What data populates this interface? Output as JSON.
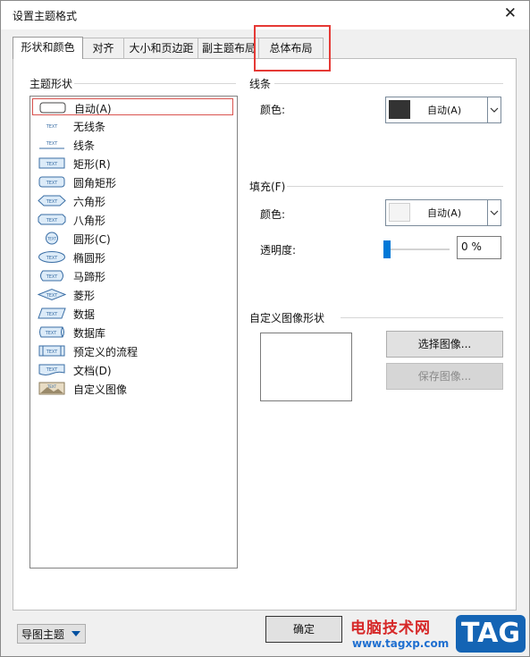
{
  "window": {
    "title": "设置主题格式",
    "close_icon": "close-icon"
  },
  "tabs": [
    {
      "label": "形状和颜色",
      "active": true
    },
    {
      "label": "对齐"
    },
    {
      "label": "大小和页边距"
    },
    {
      "label": "副主题布局"
    },
    {
      "label": "总体布局"
    }
  ],
  "shape_group": {
    "title": "主题形状",
    "items": [
      {
        "label": "自动(A)",
        "icon": "auto-shape-icon",
        "selected": true
      },
      {
        "label": "无线条",
        "icon": "no-line-shape-icon"
      },
      {
        "label": "线条",
        "icon": "line-shape-icon"
      },
      {
        "label": "矩形(R)",
        "icon": "rectangle-shape-icon"
      },
      {
        "label": "圆角矩形",
        "icon": "rounded-rectangle-shape-icon"
      },
      {
        "label": "六角形",
        "icon": "hexagon-shape-icon"
      },
      {
        "label": "八角形",
        "icon": "octagon-shape-icon"
      },
      {
        "label": "圆形(C)",
        "icon": "circle-shape-icon"
      },
      {
        "label": "椭圆形",
        "icon": "ellipse-shape-icon"
      },
      {
        "label": "马蹄形",
        "icon": "horseshoe-shape-icon"
      },
      {
        "label": "菱形",
        "icon": "diamond-shape-icon"
      },
      {
        "label": "数据",
        "icon": "data-shape-icon"
      },
      {
        "label": "数据库",
        "icon": "database-shape-icon"
      },
      {
        "label": "预定义的流程",
        "icon": "predefined-process-shape-icon"
      },
      {
        "label": "文档(D)",
        "icon": "document-shape-icon"
      },
      {
        "label": "自定义图像",
        "icon": "custom-image-shape-icon"
      }
    ],
    "icon_text": "TEXT"
  },
  "line_group": {
    "title": "线条",
    "color_label": "颜色:",
    "color_value": "自动(A)",
    "swatch_color": "#333333"
  },
  "fill_group": {
    "title": "填充(F)",
    "color_label": "颜色:",
    "color_value": "自动(A)",
    "swatch_color": "#f4f4f4",
    "transparency_label": "透明度:",
    "transparency_value": "0 %",
    "transparency": 0
  },
  "custom_image_group": {
    "title": "自定义图像形状",
    "select_button": "选择图像...",
    "save_button": "保存图像..."
  },
  "footer": {
    "dropdown_label": "导图主题",
    "ok_button": "确定"
  },
  "watermark": {
    "site_name": "电脑技术网",
    "url": "www.tagxp.com",
    "badge": "TAG"
  },
  "colors": {
    "accent": "#0078d7",
    "highlight_box": "#e53935"
  }
}
